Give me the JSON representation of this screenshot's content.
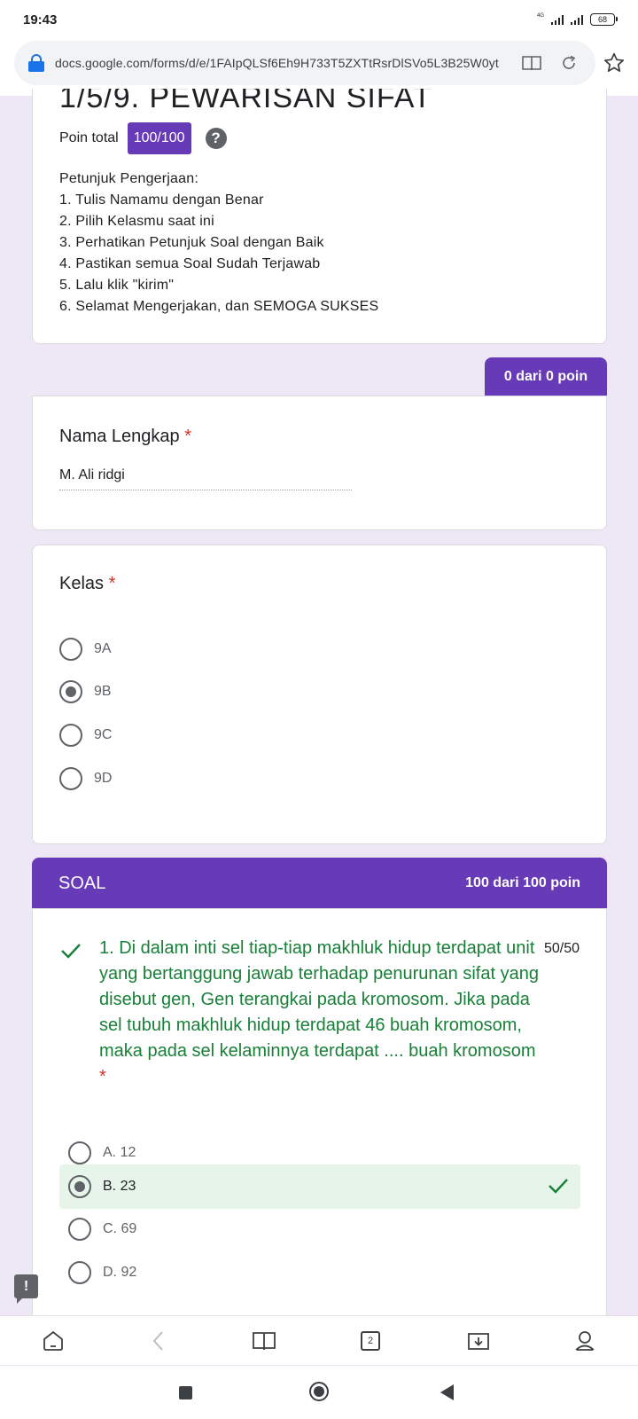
{
  "status_bar": {
    "time": "19:43",
    "network_label": "4G",
    "battery": "68"
  },
  "browser": {
    "url": "docs.google.com/forms/d/e/1FAIpQLSf6Eh9H733T5ZXTtRsrDlSVo5L3B25W0yt",
    "tab_count": "2"
  },
  "form": {
    "title": "1/5/9. PEWARISAN SIFAT",
    "points_label": "Poin total",
    "points_value": "100/100",
    "help_icon": "?",
    "instructions": [
      "Petunjuk Pengerjaan:",
      "1. Tulis Namamu dengan Benar",
      "2. Pilih Kelasmu saat ini",
      "3. Perhatikan Petunjuk Soal dengan Baik",
      "4. Pastikan semua Soal Sudah Terjawab",
      "5. Lalu klik \"kirim\"",
      "6. Selamat Mengerjakan, dan SEMOGA SUKSES"
    ],
    "score_tag": "0 dari 0 poin",
    "name_question": {
      "title": "Nama Lengkap",
      "required": "*",
      "answer": "M. Ali ridgi"
    },
    "class_question": {
      "title": "Kelas",
      "required": "*",
      "options": [
        "9A",
        "9B",
        "9C",
        "9D"
      ],
      "selected": "9B"
    },
    "section": {
      "title": "SOAL",
      "points": "100 dari 100 poin"
    },
    "question1": {
      "text": "1. Di dalam inti sel tiap-tiap makhluk hidup terdapat unit yang bertanggung jawab terhadap penurunan sifat yang disebut gen, Gen terangkai pada kromosom. Jika pada sel tubuh makhluk hidup terdapat 46 buah kromosom, maka pada sel kelaminnya terdapat .... buah kromosom",
      "required": "*",
      "score": "50/50",
      "options": [
        "A. 12",
        "B. 23",
        "C. 69",
        "D. 92"
      ],
      "selected": "B. 23",
      "correct_color": "#188038",
      "correct_bg": "#e6f4ea"
    }
  },
  "colors": {
    "accent": "#673ab7",
    "page_bg": "#ede7f6",
    "required": "#d93025"
  },
  "icons": {
    "lock": "lock-icon",
    "reader": "reader-mode-icon",
    "reload": "reload-icon",
    "star": "star-icon",
    "feedback": "feedback-icon",
    "nav": [
      "home-icon",
      "back-icon",
      "bookmarks-icon",
      "tabs-icon",
      "downloads-icon",
      "profile-icon"
    ]
  }
}
